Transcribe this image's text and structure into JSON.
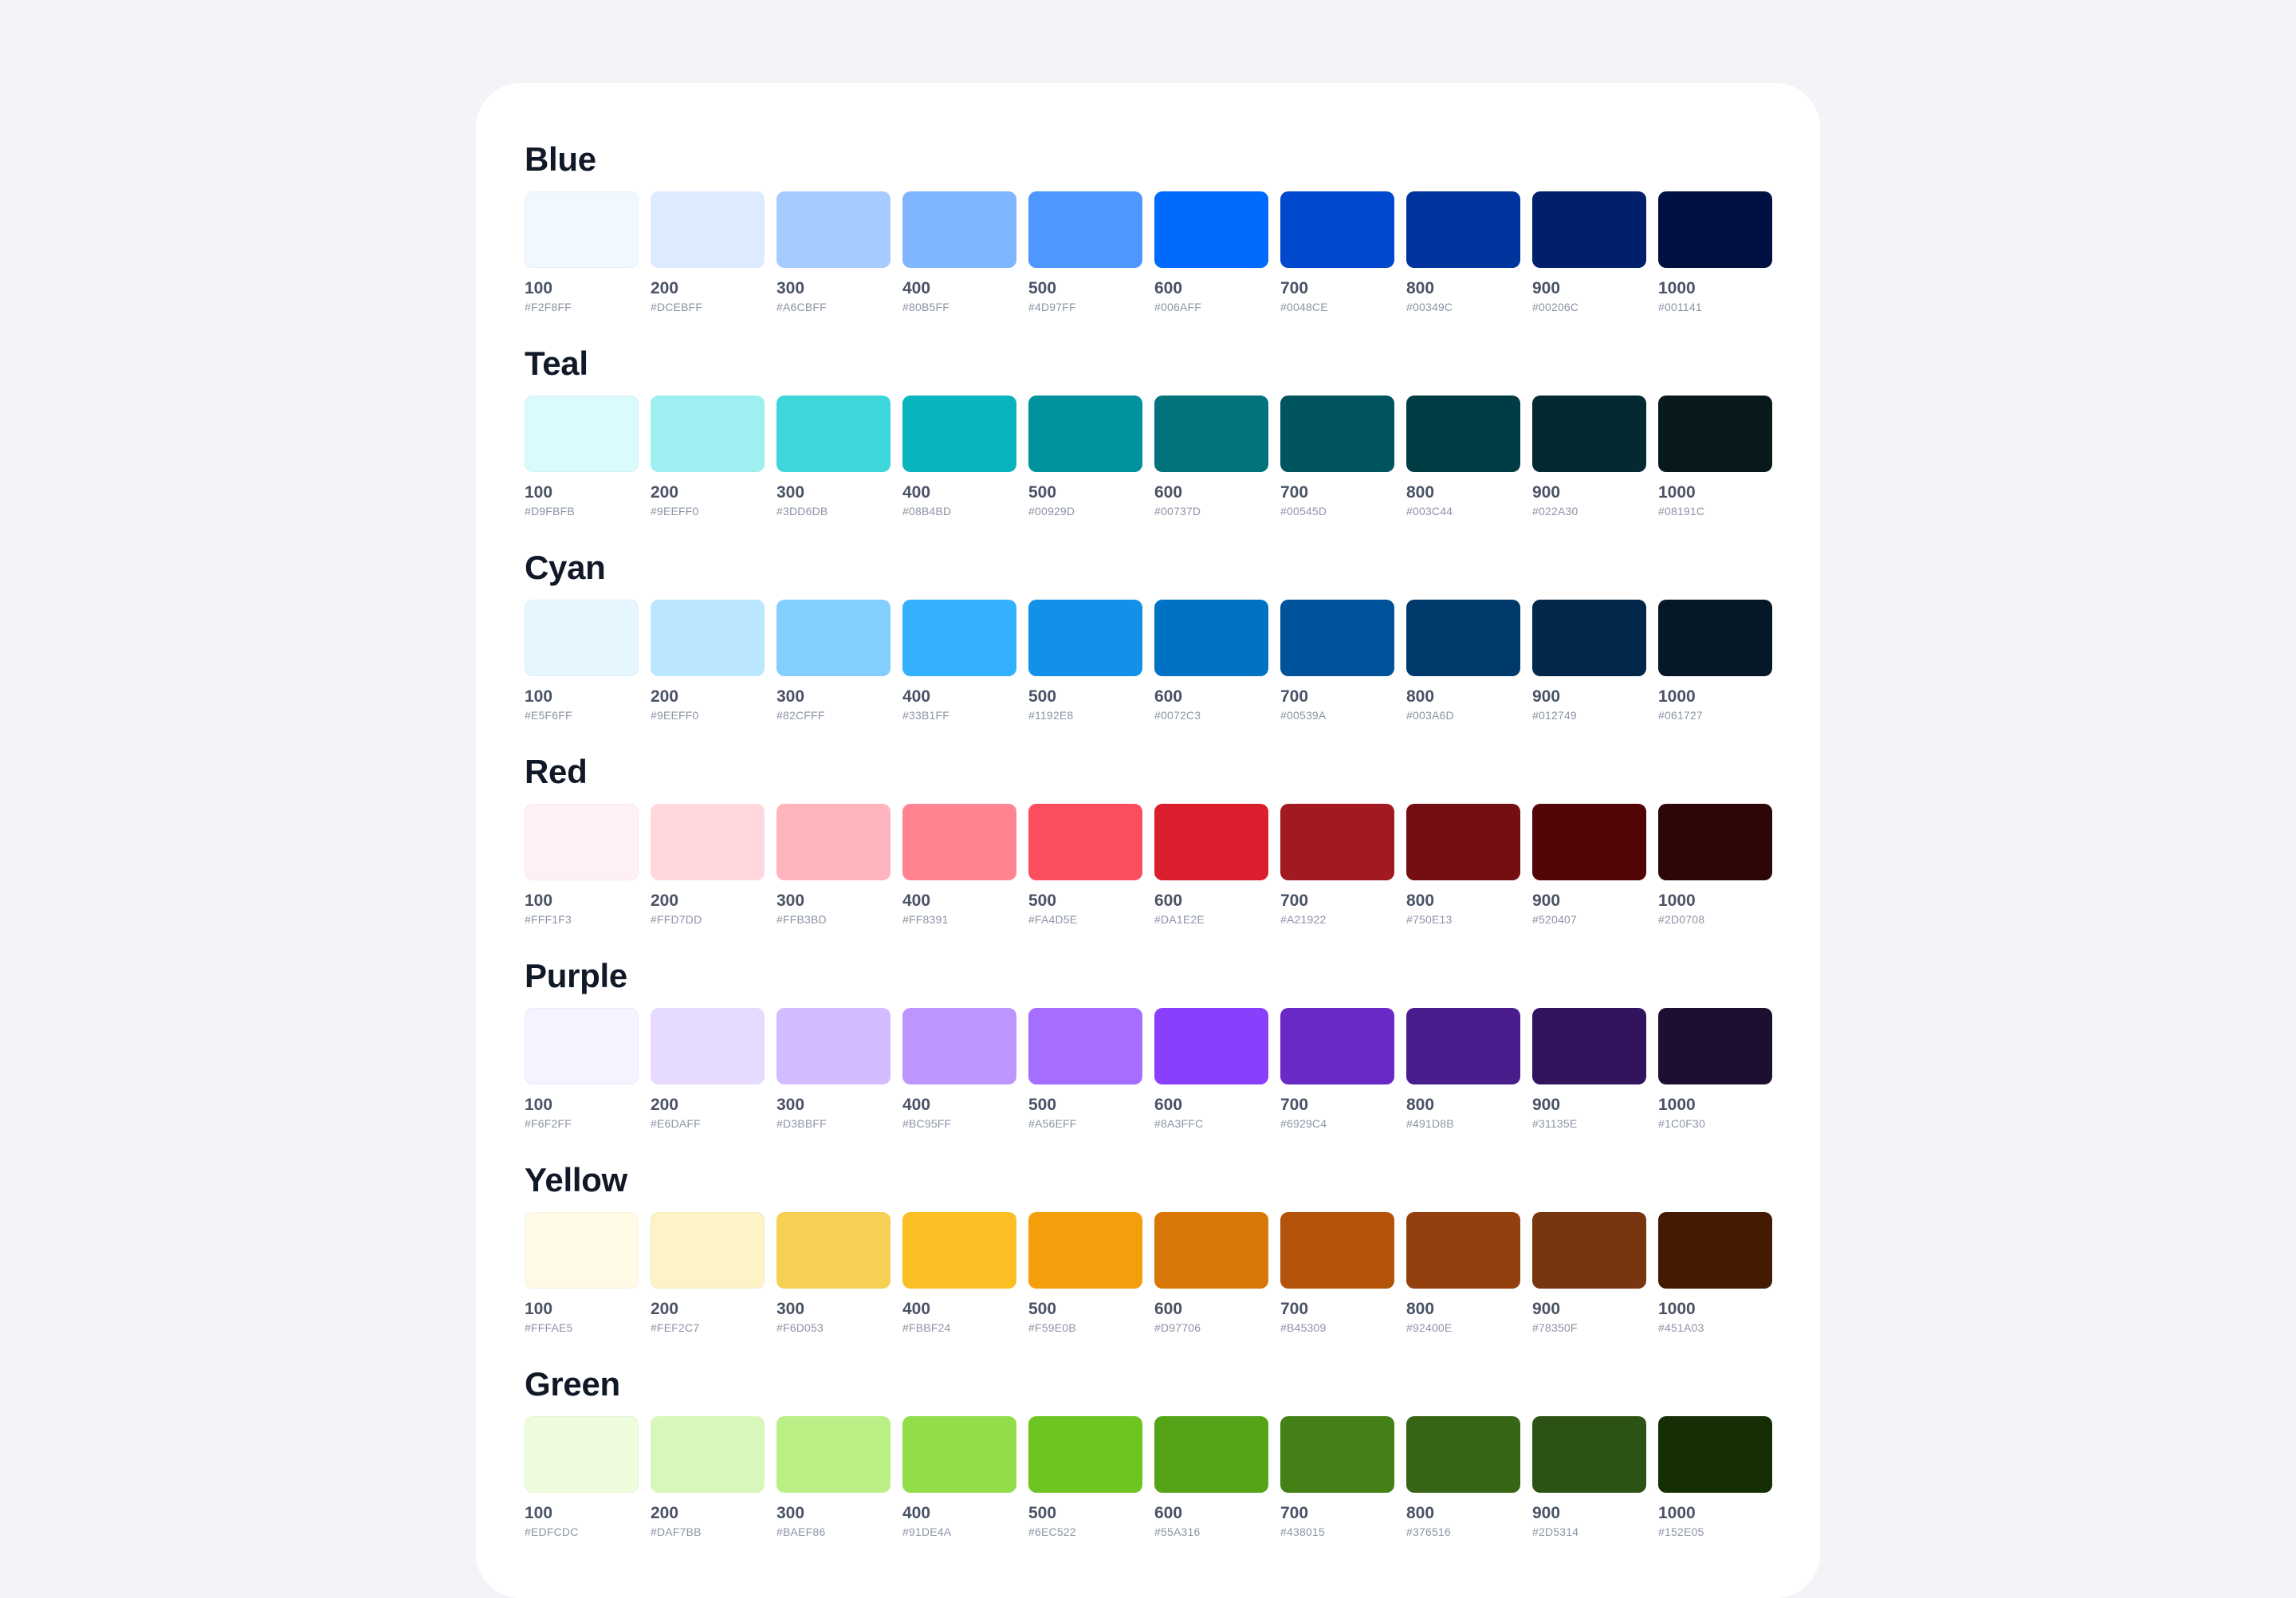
{
  "palettes": [
    {
      "name": "Blue",
      "swatches": [
        {
          "step": "100",
          "hex": "#F2F8FF",
          "color": "#F2F8FF"
        },
        {
          "step": "200",
          "hex": "#DCEBFF",
          "color": "#DCEBFF"
        },
        {
          "step": "300",
          "hex": "#A6CBFF",
          "color": "#A6CBFF"
        },
        {
          "step": "400",
          "hex": "#80B5FF",
          "color": "#80B5FF"
        },
        {
          "step": "500",
          "hex": "#4D97FF",
          "color": "#4D97FF"
        },
        {
          "step": "600",
          "hex": "#006AFF",
          "color": "#006AFF"
        },
        {
          "step": "700",
          "hex": "#0048CE",
          "color": "#0048CE"
        },
        {
          "step": "800",
          "hex": "#00349C",
          "color": "#00349C"
        },
        {
          "step": "900",
          "hex": "#00206C",
          "color": "#00206C"
        },
        {
          "step": "1000",
          "hex": "#001141",
          "color": "#001141"
        }
      ]
    },
    {
      "name": "Teal",
      "swatches": [
        {
          "step": "100",
          "hex": "#D9FBFB",
          "color": "#D9FBFB"
        },
        {
          "step": "200",
          "hex": "#9EEFF0",
          "color": "#9EEFF0"
        },
        {
          "step": "300",
          "hex": "#3DD6DB",
          "color": "#3DD6DB"
        },
        {
          "step": "400",
          "hex": "#08B4BD",
          "color": "#08B4BD"
        },
        {
          "step": "500",
          "hex": "#00929D",
          "color": "#00929D"
        },
        {
          "step": "600",
          "hex": "#00737D",
          "color": "#00737D"
        },
        {
          "step": "700",
          "hex": "#00545D",
          "color": "#00545D"
        },
        {
          "step": "800",
          "hex": "#003C44",
          "color": "#003C44"
        },
        {
          "step": "900",
          "hex": "#022A30",
          "color": "#022A30"
        },
        {
          "step": "1000",
          "hex": "#08191C",
          "color": "#08191C"
        }
      ]
    },
    {
      "name": "Cyan",
      "swatches": [
        {
          "step": "100",
          "hex": "#E5F6FF",
          "color": "#E5F6FF"
        },
        {
          "step": "200",
          "hex": "#9EEFF0",
          "color": "#BAE6FF"
        },
        {
          "step": "300",
          "hex": "#82CFFF",
          "color": "#82CFFF"
        },
        {
          "step": "400",
          "hex": "#33B1FF",
          "color": "#33B1FF"
        },
        {
          "step": "500",
          "hex": "#1192E8",
          "color": "#1192E8"
        },
        {
          "step": "600",
          "hex": "#0072C3",
          "color": "#0072C3"
        },
        {
          "step": "700",
          "hex": "#00539A",
          "color": "#00539A"
        },
        {
          "step": "800",
          "hex": "#003A6D",
          "color": "#003A6D"
        },
        {
          "step": "900",
          "hex": "#012749",
          "color": "#012749"
        },
        {
          "step": "1000",
          "hex": "#061727",
          "color": "#061727"
        }
      ]
    },
    {
      "name": "Red",
      "swatches": [
        {
          "step": "100",
          "hex": "#FFF1F3",
          "color": "#FFF1F3"
        },
        {
          "step": "200",
          "hex": "#FFD7DD",
          "color": "#FFD7DD"
        },
        {
          "step": "300",
          "hex": "#FFB3BD",
          "color": "#FFB3BD"
        },
        {
          "step": "400",
          "hex": "#FF8391",
          "color": "#FF8391"
        },
        {
          "step": "500",
          "hex": "#FA4D5E",
          "color": "#FA4D5E"
        },
        {
          "step": "600",
          "hex": "#DA1E2E",
          "color": "#DA1E2E"
        },
        {
          "step": "700",
          "hex": "#A21922",
          "color": "#A21922"
        },
        {
          "step": "800",
          "hex": "#750E13",
          "color": "#750E13"
        },
        {
          "step": "900",
          "hex": "#520407",
          "color": "#520407"
        },
        {
          "step": "1000",
          "hex": "#2D0708",
          "color": "#2D0708"
        }
      ]
    },
    {
      "name": "Purple",
      "swatches": [
        {
          "step": "100",
          "hex": "#F6F2FF",
          "color": "#F6F2FF"
        },
        {
          "step": "200",
          "hex": "#E6DAFF",
          "color": "#E6DAFF"
        },
        {
          "step": "300",
          "hex": "#D3BBFF",
          "color": "#D3BBFF"
        },
        {
          "step": "400",
          "hex": "#BC95FF",
          "color": "#BC95FF"
        },
        {
          "step": "500",
          "hex": "#A56EFF",
          "color": "#A56EFF"
        },
        {
          "step": "600",
          "hex": "#8A3FFC",
          "color": "#8A3FFC"
        },
        {
          "step": "700",
          "hex": "#6929C4",
          "color": "#6929C4"
        },
        {
          "step": "800",
          "hex": "#491D8B",
          "color": "#491D8B"
        },
        {
          "step": "900",
          "hex": "#31135E",
          "color": "#31135E"
        },
        {
          "step": "1000",
          "hex": "#1C0F30",
          "color": "#1C0F30"
        }
      ]
    },
    {
      "name": "Yellow",
      "swatches": [
        {
          "step": "100",
          "hex": "#FFFAE5",
          "color": "#FFFAE5"
        },
        {
          "step": "200",
          "hex": "#FEF2C7",
          "color": "#FEF2C7"
        },
        {
          "step": "300",
          "hex": "#F6D053",
          "color": "#F6D053"
        },
        {
          "step": "400",
          "hex": "#FBBF24",
          "color": "#FBBF24"
        },
        {
          "step": "500",
          "hex": "#F59E0B",
          "color": "#F59E0B"
        },
        {
          "step": "600",
          "hex": "#D97706",
          "color": "#D97706"
        },
        {
          "step": "700",
          "hex": "#B45309",
          "color": "#B45309"
        },
        {
          "step": "800",
          "hex": "#92400E",
          "color": "#92400E"
        },
        {
          "step": "900",
          "hex": "#78350F",
          "color": "#78350F"
        },
        {
          "step": "1000",
          "hex": "#451A03",
          "color": "#451A03"
        }
      ]
    },
    {
      "name": "Green",
      "swatches": [
        {
          "step": "100",
          "hex": "#EDFCDC",
          "color": "#EDFCDC"
        },
        {
          "step": "200",
          "hex": "#DAF7BB",
          "color": "#DAF7BB"
        },
        {
          "step": "300",
          "hex": "#BAEF86",
          "color": "#BAEF86"
        },
        {
          "step": "400",
          "hex": "#91DE4A",
          "color": "#91DE4A"
        },
        {
          "step": "500",
          "hex": "#6EC522",
          "color": "#6EC522"
        },
        {
          "step": "600",
          "hex": "#55A316",
          "color": "#55A316"
        },
        {
          "step": "700",
          "hex": "#438015",
          "color": "#438015"
        },
        {
          "step": "800",
          "hex": "#376516",
          "color": "#376516"
        },
        {
          "step": "900",
          "hex": "#2D5314",
          "color": "#2D5314"
        },
        {
          "step": "1000",
          "hex": "#152E05",
          "color": "#152E05"
        }
      ]
    }
  ]
}
